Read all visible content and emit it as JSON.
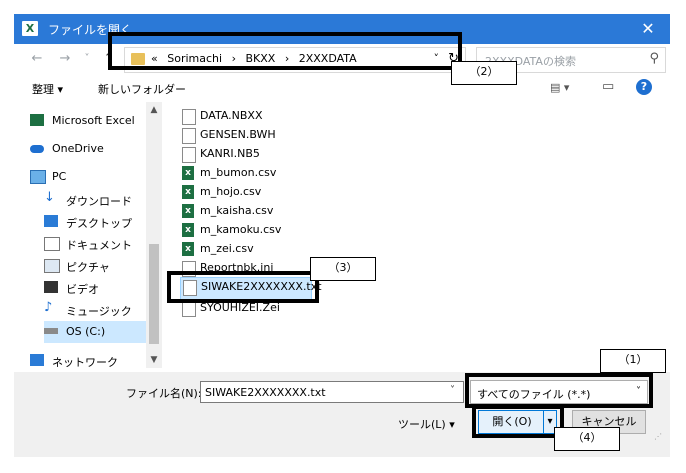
{
  "window": {
    "title": "ファイルを開く",
    "close_glyph": "✕"
  },
  "nav": {
    "back_glyph": "←",
    "forward_glyph": "→",
    "recent_glyph": "˅",
    "up_glyph": "↑",
    "address": {
      "prefix": "«",
      "crumbs": [
        "Sorimachi",
        "›",
        "BKXX",
        "›",
        "2XXXDATA"
      ],
      "dropdown_glyph": "˅",
      "refresh_glyph": "↻"
    },
    "search_placeholder": "2XXXDATAの検索",
    "search_glyph": "⚲"
  },
  "toolbar": {
    "organize": "整理 ▾",
    "new_folder": "新しいフォルダー",
    "view_glyph": "▤ ▾",
    "pane_glyph": "▭",
    "help_glyph": "?"
  },
  "sidebar": [
    {
      "label": "Microsoft Excel",
      "icon": "excel-icon"
    },
    {
      "label": "OneDrive",
      "icon": "cloud-icon"
    },
    {
      "label": "PC",
      "icon": "computer-icon"
    },
    {
      "label": "ダウンロード",
      "icon": "download-icon"
    },
    {
      "label": "デスクトップ",
      "icon": "desktop-icon"
    },
    {
      "label": "ドキュメント",
      "icon": "document-icon"
    },
    {
      "label": "ピクチャ",
      "icon": "picture-icon"
    },
    {
      "label": "ビデオ",
      "icon": "video-icon"
    },
    {
      "label": "ミュージック",
      "icon": "music-icon"
    },
    {
      "label": "OS (C:)",
      "icon": "drive-icon"
    },
    {
      "label": "ネットワーク",
      "icon": "network-icon"
    }
  ],
  "files": [
    {
      "name": "DATA.NBXX",
      "type": "txt"
    },
    {
      "name": "GENSEN.BWH",
      "type": "txt"
    },
    {
      "name": "KANRI.NB5",
      "type": "txt"
    },
    {
      "name": "m_bumon.csv",
      "type": "xls"
    },
    {
      "name": "m_hojo.csv",
      "type": "xls"
    },
    {
      "name": "m_kaisha.csv",
      "type": "xls"
    },
    {
      "name": "m_kamoku.csv",
      "type": "xls"
    },
    {
      "name": "m_zei.csv",
      "type": "xls"
    },
    {
      "name": "Reportnbk.ini",
      "type": "txt"
    },
    {
      "name": "SIWAKE2XXXXXXX.txt",
      "type": "txt"
    },
    {
      "name": "SYOUHIZEI.Zei",
      "type": "txt"
    }
  ],
  "bottom": {
    "filename_label": "ファイル名(N):",
    "filename_value": "SIWAKE2XXXXXXX.txt",
    "filetype_value": "すべてのファイル (*.*)",
    "tools_label": "ツール(L)  ▾",
    "open_label": "開く(O)",
    "open_dropdown": "▾",
    "cancel_label": "キャンセル"
  },
  "annotations": [
    "（1）",
    "（2）",
    "（3）",
    "（4）"
  ]
}
